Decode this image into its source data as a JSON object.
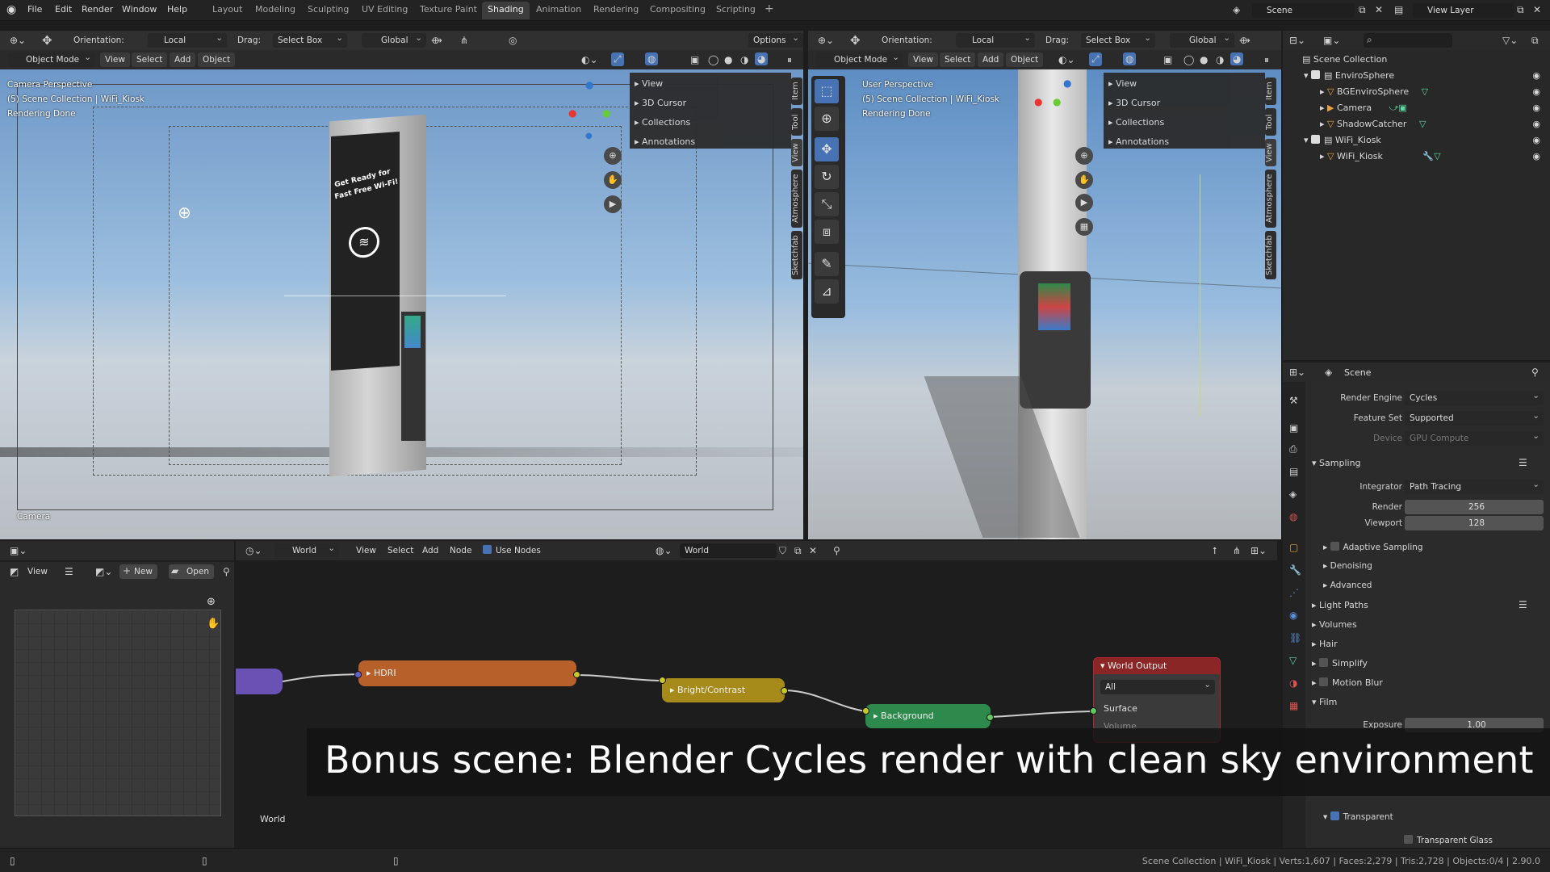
{
  "menus": [
    "File",
    "Edit",
    "Render",
    "Window",
    "Help"
  ],
  "workspaces": [
    "Layout",
    "Modeling",
    "Sculpting",
    "UV Editing",
    "Texture Paint",
    "Shading",
    "Animation",
    "Rendering",
    "Compositing",
    "Scripting"
  ],
  "active_workspace": "Shading",
  "scene_field": "Scene",
  "view_layer_field": "View Layer",
  "vp_header": {
    "orientation_label": "Orientation:",
    "orientation_value": "Local",
    "drag_label": "Drag:",
    "drag_value": "Select Box",
    "transform_value": "Global",
    "options": "Options"
  },
  "vp_header2": {
    "mode": "Object Mode",
    "view": "View",
    "select": "Select",
    "add": "Add",
    "object": "Object"
  },
  "left_viewport": {
    "line1": "Camera Perspective",
    "line2": "(5) Scene Collection | WiFi_Kiosk",
    "line3": "Rendering Done",
    "camera_label": "Camera",
    "kiosk_text1": "Get Ready for",
    "kiosk_text2": "Fast Free Wi-Fi!"
  },
  "right_viewport": {
    "line1": "User Perspective",
    "line2": "(5) Scene Collection | WiFi_Kiosk",
    "line3": "Rendering Done"
  },
  "npanel_items": [
    "View",
    "3D Cursor",
    "Collections",
    "Annotations"
  ],
  "side_tabs_left": [
    "Item",
    "Tool",
    "View",
    "Atmosphere",
    "Sketchfab"
  ],
  "side_tabs_right": [
    "Item",
    "Tool",
    "View",
    "Atmosphere",
    "Sketchfab"
  ],
  "image_editor": {
    "view": "View",
    "new": "New",
    "open": "Open",
    "world_label": "World"
  },
  "node_editor": {
    "type": "World",
    "view": "View",
    "select": "Select",
    "add": "Add",
    "node": "Node",
    "use_nodes": "Use Nodes",
    "world_field": "World"
  },
  "nodes": {
    "hdri": "HDRI",
    "bright": "Bright/Contrast",
    "background": "Background",
    "output_title": "World Output",
    "output_target": "All",
    "surface": "Surface",
    "volume": "Volume"
  },
  "outliner": {
    "root": "Scene Collection",
    "items": [
      {
        "name": "EnviroSphere",
        "type": "collection"
      },
      {
        "name": "BGEnviroSphere",
        "type": "mesh"
      },
      {
        "name": "Camera",
        "type": "camera"
      },
      {
        "name": "ShadowCatcher",
        "type": "mesh"
      },
      {
        "name": "WiFi_Kiosk",
        "type": "collection"
      },
      {
        "name": "WiFi_Kiosk",
        "type": "mesh"
      }
    ]
  },
  "properties": {
    "title": "Scene",
    "render_engine_label": "Render Engine",
    "render_engine": "Cycles",
    "feature_set_label": "Feature Set",
    "feature_set": "Supported",
    "device_label": "Device",
    "device": "GPU Compute",
    "sampling": "Sampling",
    "integrator_label": "Integrator",
    "integrator": "Path Tracing",
    "render_label": "Render",
    "render_samples": "256",
    "viewport_label": "Viewport",
    "viewport_samples": "128",
    "adaptive": "Adaptive Sampling",
    "denoising": "Denoising",
    "advanced": "Advanced",
    "light_paths": "Light Paths",
    "volumes": "Volumes",
    "hair": "Hair",
    "simplify": "Simplify",
    "motion_blur": "Motion Blur",
    "film": "Film",
    "exposure_label": "Exposure",
    "exposure": "1.00",
    "transparent": "Transparent",
    "transparent_glass": "Transparent Glass"
  },
  "caption": "Bonus scene: Blender Cycles render with clean sky environment",
  "status_bar": "Scene Collection | WiFi_Kiosk | Verts:1,607 | Faces:2,279 | Tris:2,728 | Objects:0/4 | 2.90.0"
}
